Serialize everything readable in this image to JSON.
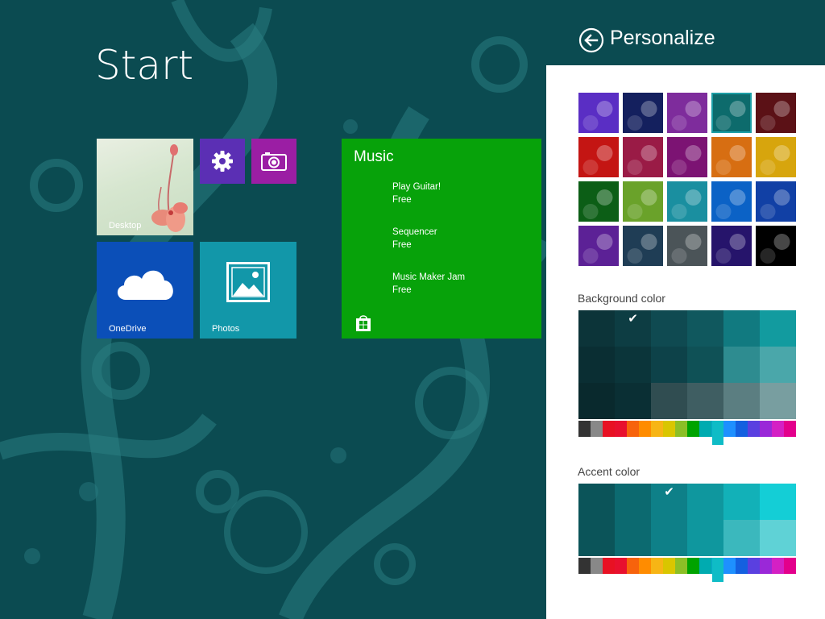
{
  "start": {
    "title": "Start",
    "tiles": {
      "desktop": "Desktop",
      "onedrive": "OneDrive",
      "photos": "Photos",
      "music": {
        "title": "Music",
        "items": [
          {
            "name": "Play Guitar!",
            "price": "Free"
          },
          {
            "name": "Sequencer",
            "price": "Free"
          },
          {
            "name": "Music Maker Jam",
            "price": "Free"
          }
        ]
      }
    },
    "icons": {
      "settings": "gear-icon",
      "camera": "camera-icon",
      "onedrive": "cloud-icon",
      "photos": "photo-icon",
      "store": "store-icon"
    }
  },
  "pane": {
    "title": "Personalize",
    "back_icon": "back-arrow-icon",
    "background_color_label": "Background color",
    "accent_color_label": "Accent color",
    "patterns": [
      [
        "#5a2ec4",
        "#14205e",
        "#7e2c9c",
        "#0d6b6c",
        "#5b1116"
      ],
      [
        "#c41513",
        "#9a1b46",
        "#7c1373",
        "#d76e12",
        "#d7a50d"
      ],
      [
        "#0c5e16",
        "#6aa22a",
        "#1a8fa0",
        "#0b62c6",
        "#1140a5"
      ],
      [
        "#5c2196",
        "#1f3d55",
        "#4b5458",
        "#26146b",
        "#000000"
      ]
    ],
    "selected_pattern": [
      0,
      3
    ],
    "background_swatches": [
      [
        "#0c3439",
        "#0d3d43",
        "#0f4a51",
        "#10585e",
        "#117a80",
        "#129b9f"
      ],
      [
        "#0a2e33",
        "#0b353a",
        "#0d4249",
        "#0f5156",
        "#2e8c90",
        "#4aa7aa"
      ],
      [
        "#09292d",
        "#0a2f34",
        "#304d51",
        "#3f5e62",
        "#5b7e81",
        "#789ea0"
      ]
    ],
    "background_selected": [
      0,
      1
    ],
    "accent_swatches": [
      [
        "#0b5459",
        "#0c6a70",
        "#0e8088",
        "#0f979e",
        "#12b1b8",
        "#14ced6"
      ],
      [
        "#0b5459",
        "#0c6a70",
        "#0e8088",
        "#0f979e",
        "#3bb8bd",
        "#5fd2d6"
      ]
    ],
    "accent_selected": [
      0,
      2
    ],
    "hue_colors": [
      "#333333",
      "#888888",
      "#e81123",
      "#e8102e",
      "#f7630c",
      "#ff8c00",
      "#f7b515",
      "#d9c600",
      "#8cbf26",
      "#00a300",
      "#00abb0",
      "#0ba9c9",
      "#1e90ff",
      "#1460e0",
      "#5a40e0",
      "#9a28d8",
      "#d420c4",
      "#e3008c"
    ],
    "hue_thumb_index": 11
  },
  "colors": {
    "start_bg": "#0b4b51",
    "music_tile": "#07a20a",
    "onedrive_tile": "#0b4fb8",
    "photos_tile": "#1297a9",
    "settings_tile": "#5b2fb4",
    "camera_tile": "#9b1ea4"
  }
}
